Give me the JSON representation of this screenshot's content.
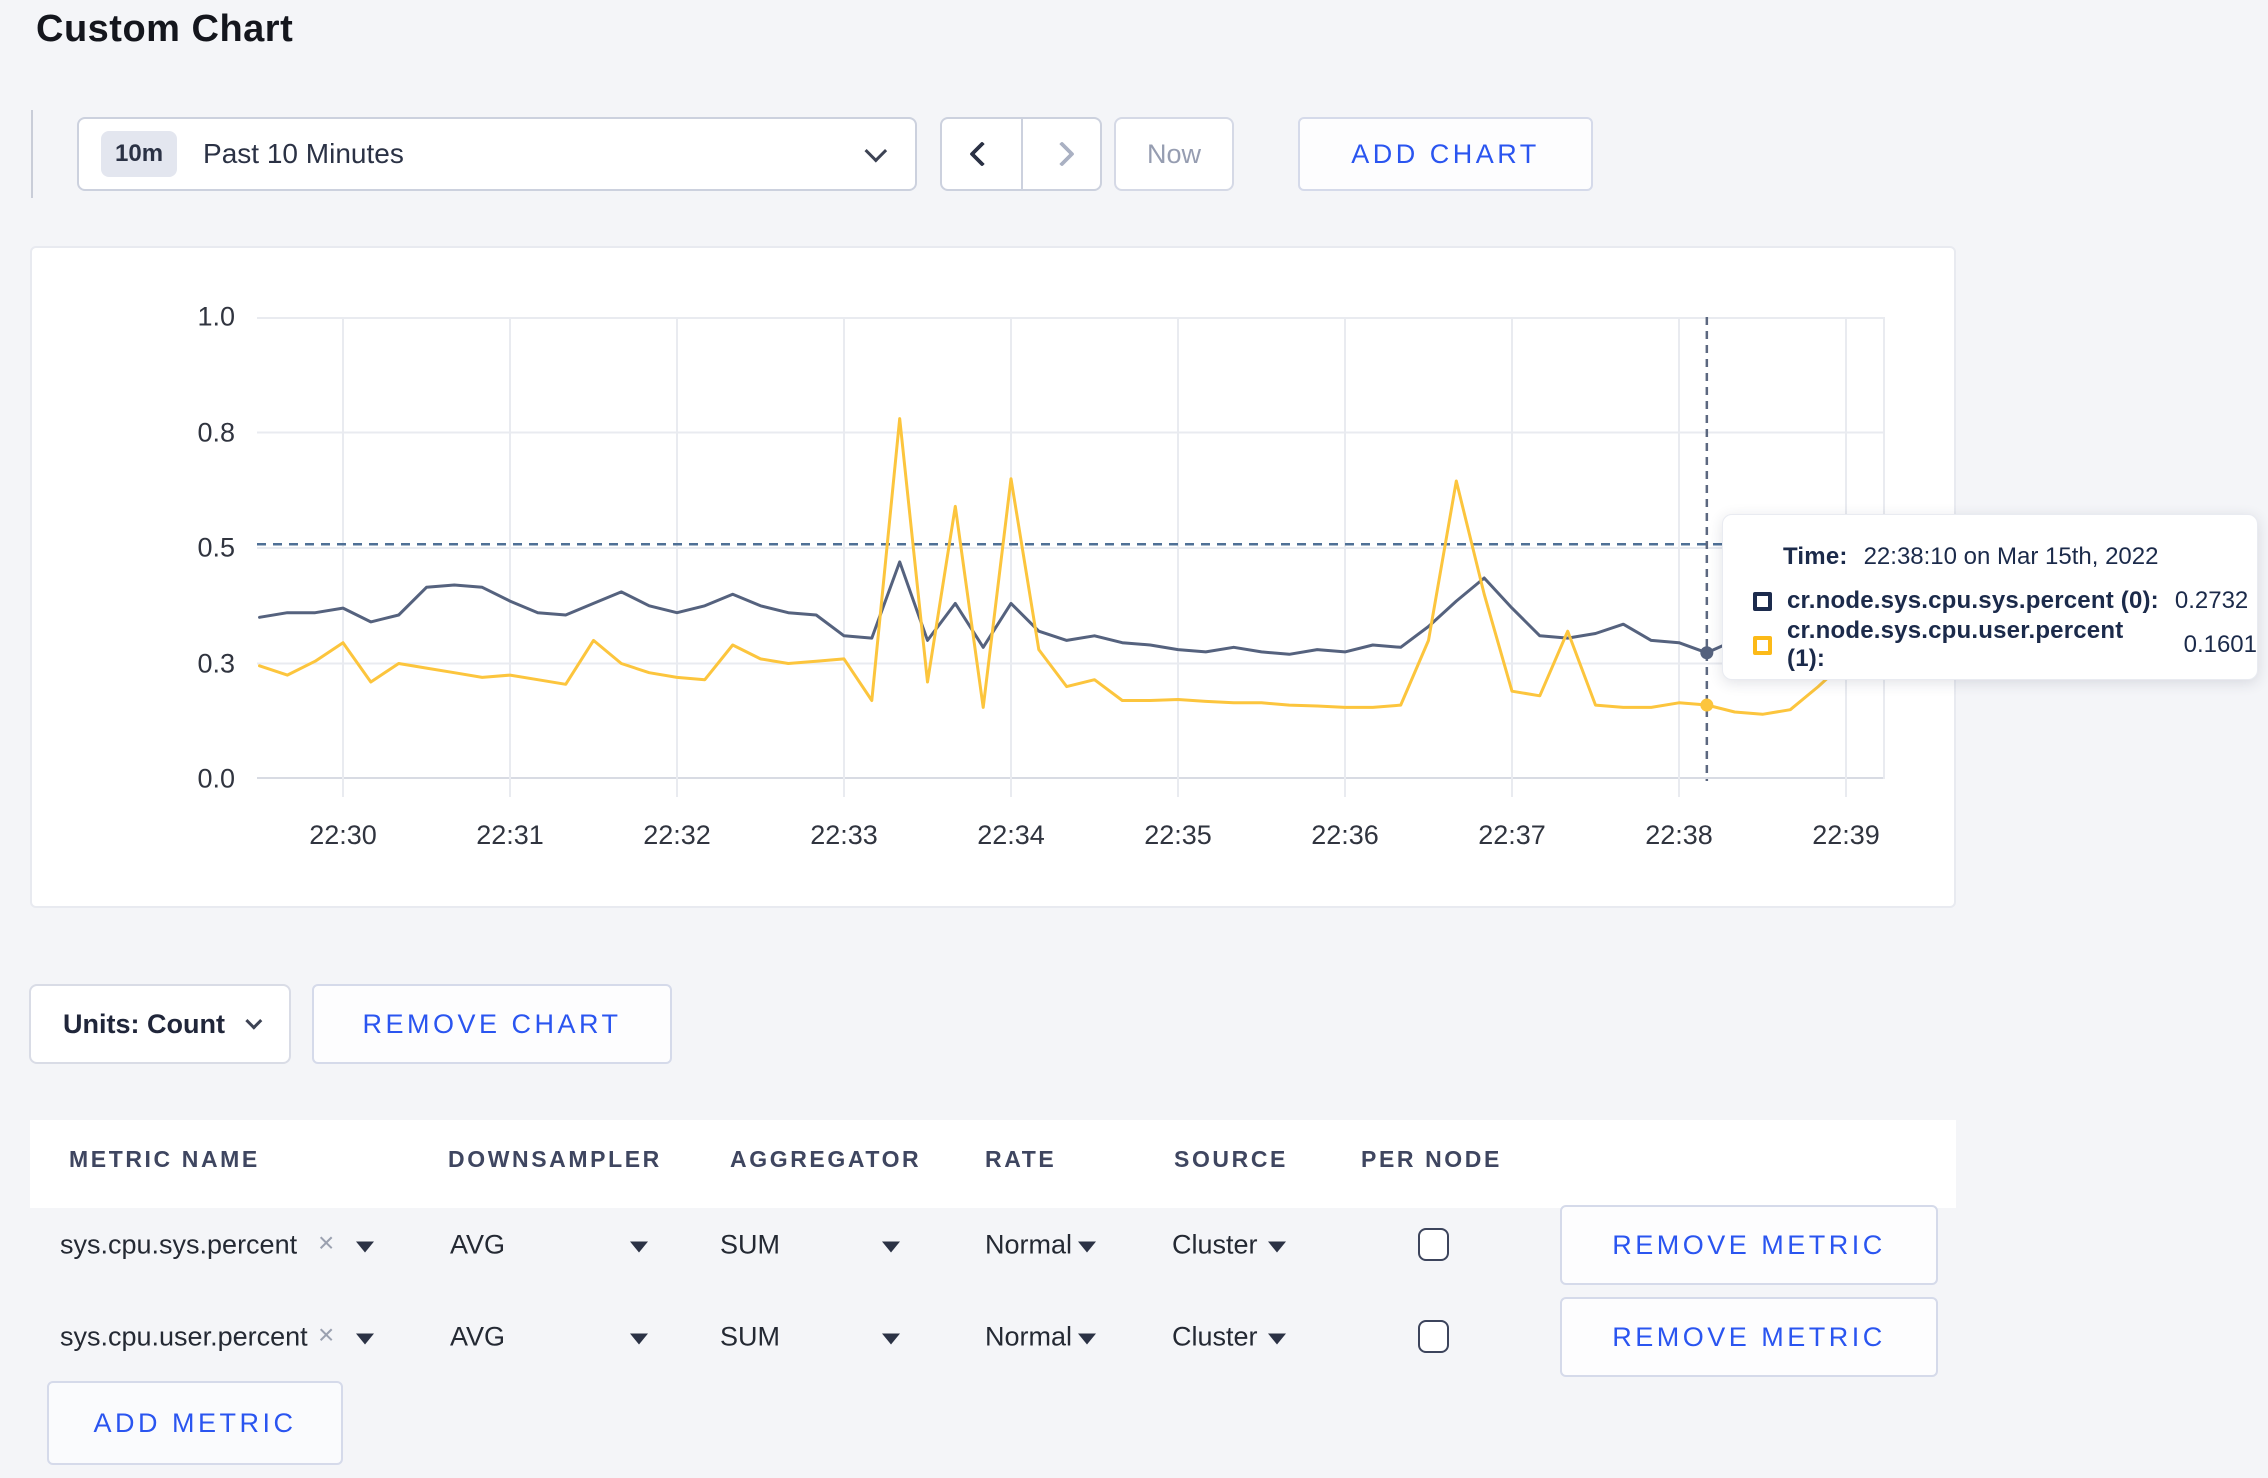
{
  "page": {
    "title": "Custom Chart",
    "accent_blue": "#2a55f0",
    "background": "#f4f5f8"
  },
  "toolbar": {
    "range": {
      "badge": "10m",
      "label": "Past 10 Minutes"
    },
    "now_label": "Now",
    "add_chart_label": "ADD CHART"
  },
  "tooltip": {
    "time_label": "Time:",
    "time_value": "22:38:10 on Mar 15th, 2022",
    "rows": [
      {
        "name": "cr.node.sys.cpu.sys.percent (0):",
        "value": "0.2732",
        "color": "#1c2b4d"
      },
      {
        "name": "cr.node.sys.cpu.user.percent (1):",
        "value": "0.1601",
        "color": "#fcba18"
      }
    ]
  },
  "chart_controls": {
    "units_label": "Units: Count",
    "remove_chart_label": "REMOVE CHART"
  },
  "metrics_table": {
    "headers": [
      "METRIC NAME",
      "DOWNSAMPLER",
      "AGGREGATOR",
      "RATE",
      "SOURCE",
      "PER NODE"
    ],
    "rows": [
      {
        "name": "sys.cpu.sys.percent",
        "remove_icon": "×",
        "downsampler": "AVG",
        "aggregator": "SUM",
        "rate": "Normal",
        "source": "Cluster",
        "per_node_checked": false,
        "remove_label": "REMOVE METRIC"
      },
      {
        "name": "sys.cpu.user.percent",
        "remove_icon": "×",
        "downsampler": "AVG",
        "aggregator": "SUM",
        "rate": "Normal",
        "source": "Cluster",
        "per_node_checked": false,
        "remove_label": "REMOVE METRIC"
      }
    ],
    "add_metric_label": "ADD METRIC"
  },
  "chart_data": {
    "type": "line",
    "title": "",
    "xlabel": "",
    "ylabel": "",
    "ylim": [
      0,
      1
    ],
    "grid": true,
    "x_ticks": [
      "22:30",
      "22:31",
      "22:32",
      "22:33",
      "22:34",
      "22:35",
      "22:36",
      "22:37",
      "22:38",
      "22:39"
    ],
    "y_ticks": [
      "1.0",
      "0.8",
      "0.5",
      "0.3",
      "0.0"
    ],
    "time_start_sec": -30,
    "time_step_sec": 10,
    "threshold_value": 0.508,
    "crosshair": {
      "time_sec": 490,
      "time_label": "22:38:10",
      "values": [
        0.2732,
        0.1601
      ]
    },
    "series": [
      {
        "name": "cr.node.sys.cpu.sys.percent",
        "color": "#55627e",
        "values": [
          0.35,
          0.36,
          0.36,
          0.37,
          0.34,
          0.355,
          0.415,
          0.42,
          0.415,
          0.385,
          0.36,
          0.355,
          0.38,
          0.405,
          0.375,
          0.36,
          0.375,
          0.4,
          0.375,
          0.36,
          0.355,
          0.31,
          0.305,
          0.47,
          0.3,
          0.38,
          0.285,
          0.38,
          0.32,
          0.3,
          0.31,
          0.295,
          0.29,
          0.28,
          0.275,
          0.285,
          0.275,
          0.27,
          0.28,
          0.275,
          0.29,
          0.285,
          0.33,
          0.385,
          0.435,
          0.37,
          0.31,
          0.305,
          0.315,
          0.335,
          0.3,
          0.295,
          0.2732,
          0.3,
          0.295,
          0.3,
          0.305,
          0.3,
          0.3
        ]
      },
      {
        "name": "cr.node.sys.cpu.user.percent",
        "color": "#fcc53d",
        "values": [
          0.245,
          0.225,
          0.255,
          0.295,
          0.21,
          0.25,
          0.24,
          0.23,
          0.22,
          0.225,
          0.215,
          0.205,
          0.3,
          0.25,
          0.23,
          0.22,
          0.215,
          0.29,
          0.26,
          0.25,
          0.255,
          0.26,
          0.17,
          0.78,
          0.21,
          0.59,
          0.155,
          0.65,
          0.28,
          0.2,
          0.215,
          0.17,
          0.17,
          0.172,
          0.168,
          0.165,
          0.165,
          0.16,
          0.158,
          0.155,
          0.155,
          0.16,
          0.3,
          0.645,
          0.4,
          0.19,
          0.18,
          0.32,
          0.16,
          0.155,
          0.155,
          0.165,
          0.1601,
          0.145,
          0.14,
          0.15,
          0.2,
          0.255,
          0.27
        ]
      }
    ]
  }
}
